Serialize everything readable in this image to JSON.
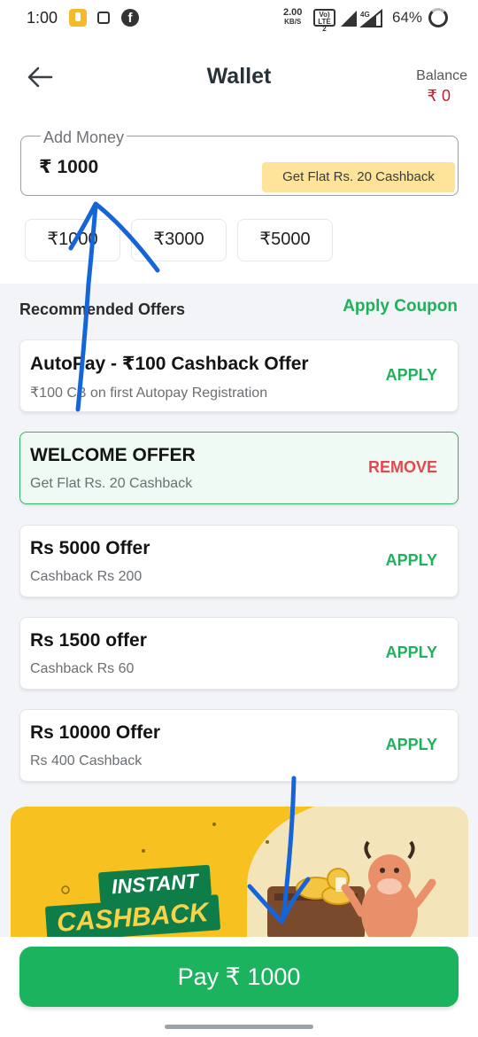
{
  "status_bar": {
    "time": "1:00",
    "net_speed_value": "2.00",
    "net_speed_unit": "KB/S",
    "volte": "Vo) LTE 2",
    "network": "4G",
    "battery": "64%"
  },
  "header": {
    "title": "Wallet",
    "balance_label": "Balance",
    "balance_value": "₹ 0"
  },
  "add_money": {
    "legend": "Add Money",
    "amount": "₹ 1000",
    "cashback_chip": "Get Flat Rs. 20 Cashback"
  },
  "quick_amounts": [
    "₹1000",
    "₹3000",
    "₹5000"
  ],
  "offers": {
    "heading": "Recommended Offers",
    "apply_coupon": "Apply Coupon",
    "items": [
      {
        "title": "AutoPay - ₹100 Cashback Offer",
        "subtitle": "₹100 CB on first Autopay Registration",
        "action": "APPLY",
        "active": false
      },
      {
        "title": "WELCOME OFFER",
        "subtitle": "Get Flat Rs. 20 Cashback",
        "action": "REMOVE",
        "active": true
      },
      {
        "title": "Rs 5000 Offer",
        "subtitle": "Cashback Rs 200",
        "action": "APPLY",
        "active": false
      },
      {
        "title": "Rs 1500 offer",
        "subtitle": "Cashback Rs 60",
        "action": "APPLY",
        "active": false
      },
      {
        "title": "Rs 10000 Offer",
        "subtitle": "Rs 400 Cashback",
        "action": "APPLY",
        "active": false
      }
    ]
  },
  "banner": {
    "line1": "INSTANT",
    "line2": "CASHBACK"
  },
  "pay_button": "Pay ₹ 1000",
  "colors": {
    "accent_green": "#1cb35e",
    "remove_red": "#e5474f",
    "balance_red": "#c41e2a",
    "chip_yellow": "#fde49a",
    "banner_yellow": "#f7c21f",
    "annotation_blue": "#1565d8"
  }
}
